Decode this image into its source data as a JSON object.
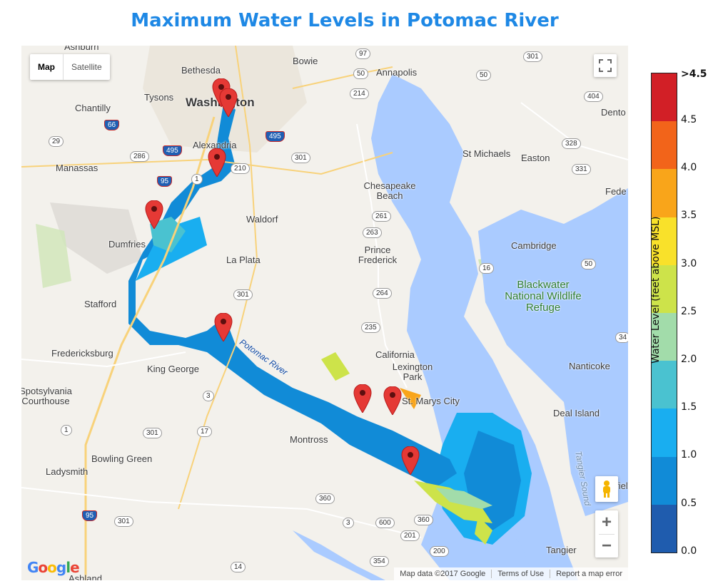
{
  "title": "Maximum Water Levels in Potomac River",
  "map_type": {
    "map_label": "Map",
    "satellite_label": "Satellite",
    "selected": "Map"
  },
  "zoom": {
    "in_label": "+",
    "out_label": "−"
  },
  "logo": "Google",
  "attribution": {
    "data": "Map data ©2017 Google",
    "terms": "Terms of Use",
    "report": "Report a map error"
  },
  "places": {
    "ashburn": "Ashburn",
    "bethesda": "Bethesda",
    "bowie": "Bowie",
    "annapolis": "Annapolis",
    "tysons": "Tysons",
    "washington": "Washington",
    "chantilly": "Chantilly",
    "alexandria": "Alexandria",
    "manassas": "Manassas",
    "chesapeake_beach": "Chesapeake Beach",
    "st_michaels": "St Michaels",
    "easton": "Easton",
    "denton": "Dento",
    "federalsburg": "Fede",
    "waldorf": "Waldorf",
    "dumfries": "Dumfries",
    "la_plata": "La Plata",
    "prince_frederick": "Prince Frederick",
    "cambridge": "Cambridge",
    "blackwater": "Blackwater National Wildlife Refuge",
    "stafford": "Stafford",
    "fredericksburg": "Fredericksburg",
    "california": "California",
    "lexington_park": "Lexington Park",
    "nanticoke": "Nanticoke",
    "king_george": "King George",
    "st_marys": "St. Marys City",
    "spotsylvania": "Spotsylvania Courthouse",
    "deal_island": "Deal Island",
    "montross": "Montross",
    "bowling_green": "Bowling Green",
    "ladysmith": "Ladysmith",
    "tangier": "Tangier",
    "ashland": "Ashland",
    "crisfield": "Crisfield",
    "tangier_sound": "Tangier Sound",
    "potomac_river": "Potomac River"
  },
  "shields": [
    "97",
    "301",
    "50",
    "50",
    "214",
    "404",
    "66",
    "495",
    "495",
    "29",
    "286",
    "301",
    "328",
    "210",
    "331",
    "95",
    "1",
    "261",
    "263",
    "16",
    "50",
    "301",
    "264",
    "235",
    "34",
    "3",
    "17",
    "1",
    "301",
    "360",
    "3",
    "600",
    "360",
    "201",
    "95",
    "301",
    "354",
    "200",
    "14"
  ],
  "legend": {
    "title": "Water Level (feet above MSL)",
    "colors": [
      "#d21f26",
      "#f2641a",
      "#f9a51a",
      "#f9e12a",
      "#cde34a",
      "#a2dcaa",
      "#4ac2d0",
      "#19aef0",
      "#118bd7",
      "#1f5cae"
    ],
    "ticks": [
      ">4.5",
      "4.5",
      "4.0",
      "3.5",
      "3.0",
      "2.5",
      "2.0",
      "1.5",
      "1.0",
      "0.5",
      "0.0"
    ]
  },
  "colors": {
    "title": "#1e88e5",
    "bay": "#aacbff",
    "marker": "#e53935",
    "land": "#f3f1ec"
  },
  "icons": [
    "fullscreen-icon",
    "pegman-icon",
    "map-marker-icon"
  ]
}
